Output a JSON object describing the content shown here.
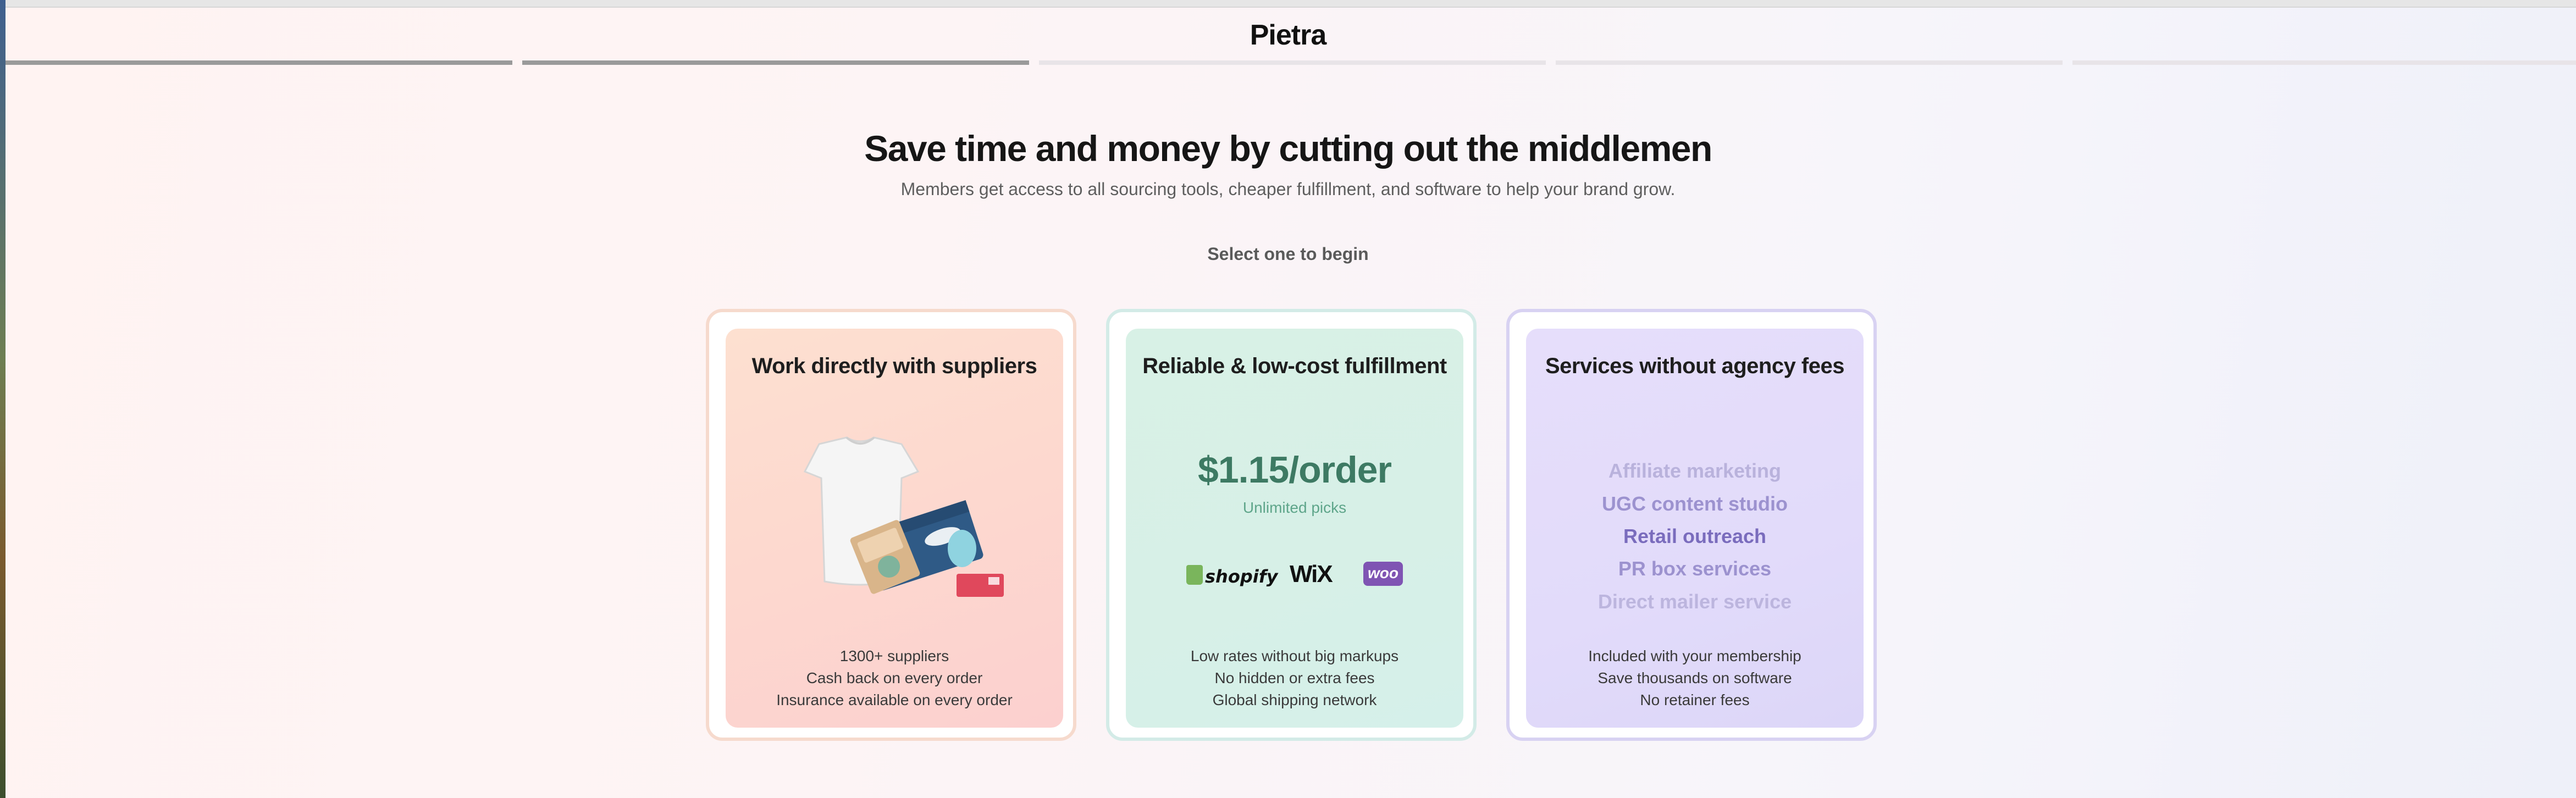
{
  "header": {
    "brand": "Pietra"
  },
  "progress": {
    "total_steps": 5,
    "completed_steps": 2
  },
  "main": {
    "headline": "Save time and money by cutting out the middlemen",
    "subheadline": "Members get access to all sourcing tools, cheaper fulfillment, and software to help your brand grow.",
    "select_prompt": "Select one to begin"
  },
  "cards": [
    {
      "title": "Work directly with suppliers",
      "features": [
        "1300+ suppliers",
        "Cash back on every order",
        "Insurance available on every order"
      ],
      "accent": "#f6dacd"
    },
    {
      "title": "Reliable & low-cost fulfillment",
      "price": "$1.15/order",
      "price_note": "Unlimited picks",
      "logos": [
        "shopify",
        "WiX",
        "woo"
      ],
      "features": [
        "Low rates without big markups",
        "No hidden or extra fees",
        "Global shipping network"
      ],
      "accent": "#d3ebe7"
    },
    {
      "title": "Services without agency fees",
      "services": [
        "Affiliate marketing",
        "UGC content studio",
        "Retail outreach",
        "PR box services",
        "Direct mailer service"
      ],
      "features": [
        "Included with your membership",
        "Save thousands on software",
        "No retainer fees"
      ],
      "accent": "#d8d2f2"
    }
  ],
  "colors": {
    "price_green": "#3d7a63",
    "service_purple": "#7a6cbd",
    "progress_done": "#9a9a9a",
    "progress_todo": "#e8e4e8"
  }
}
